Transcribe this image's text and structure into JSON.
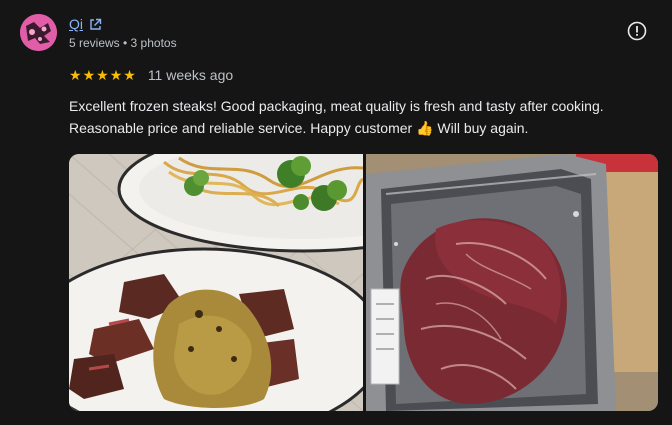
{
  "reviewer": {
    "name": "Qi",
    "meta": "5 reviews • 3 photos"
  },
  "review": {
    "rating": 5,
    "max_rating": 5,
    "date": "11 weeks ago",
    "text_line1": "Excellent frozen steaks! Good packaging, meat quality is fresh and tasty after cooking.",
    "text_line2": "Reasonable price and reliable service. Happy customer 👍 Will buy again."
  },
  "icons": {
    "external_link": "external-link-icon",
    "report": "report-icon",
    "star": "star-icon"
  },
  "colors": {
    "background": "#151515",
    "link": "#8ab4f8",
    "star": "#fbbc04",
    "avatar": "#e25da7"
  }
}
